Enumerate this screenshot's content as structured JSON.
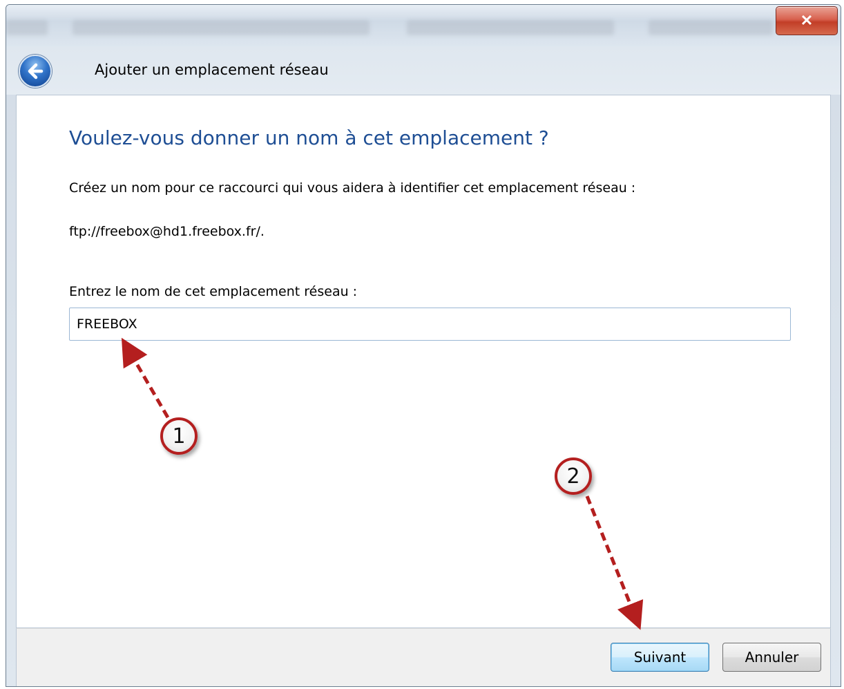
{
  "window": {
    "close_glyph": "✕"
  },
  "nav": {
    "title": "Ajouter un emplacement réseau"
  },
  "main": {
    "heading": "Voulez-vous donner un nom à cet emplacement ?",
    "description": "Créez un nom pour ce raccourci qui vous aidera à identifier cet emplacement réseau :",
    "address": "ftp://freebox@hd1.freebox.fr/.",
    "name_label": "Entrez le nom de cet emplacement réseau :",
    "name_value": "FREEBOX"
  },
  "footer": {
    "next_label": "Suivant",
    "cancel_label": "Annuler"
  },
  "annotations": {
    "callout_1": "1",
    "callout_2": "2",
    "arrow_color": "#b41f1f"
  }
}
